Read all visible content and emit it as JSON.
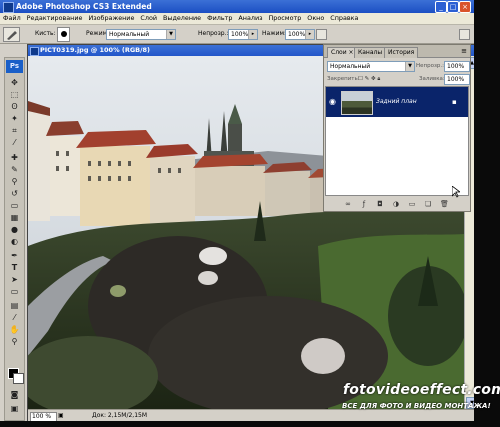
{
  "app": {
    "title": "Adobe Photoshop CS3 Extended",
    "ps_badge": "Ps"
  },
  "menu": [
    "Файл",
    "Редактирование",
    "Изображение",
    "Слой",
    "Выделение",
    "Фильтр",
    "Анализ",
    "Просмотр",
    "Окно",
    "Справка"
  ],
  "options": {
    "brush_label": "Кисть:",
    "mode_label": "Режим:",
    "mode_value": "Нормальный",
    "opacity_label": "Непрозр.:",
    "opacity_value": "100%",
    "flow_label": "Нажим:",
    "flow_value": "100%"
  },
  "document": {
    "title": "PICT0319.jpg @ 100% (RGB/8)",
    "zoom": "100 %",
    "doc_info": "Док: 2,15M/2,15M"
  },
  "layers_panel": {
    "tabs": [
      "Слои ×",
      "Каналы",
      "История"
    ],
    "blend_mode": "Нормальный",
    "opacity_label": "Непрозр.:",
    "opacity_value": "100%",
    "lock_label": "Закрепить:",
    "fill_label": "Заливка:",
    "fill_value": "100%",
    "layer_name": "Задний план"
  },
  "watermark": {
    "site": "fotovideoeffect.com",
    "slogan": "ВСЕ ДЛЯ ФОТО И ВИДЕО МОНТАЖА!"
  },
  "colors": {
    "titlebar": "#2256c9",
    "layer_selected": "#0a246a",
    "foreground": "#000000",
    "background": "#ffffff"
  }
}
